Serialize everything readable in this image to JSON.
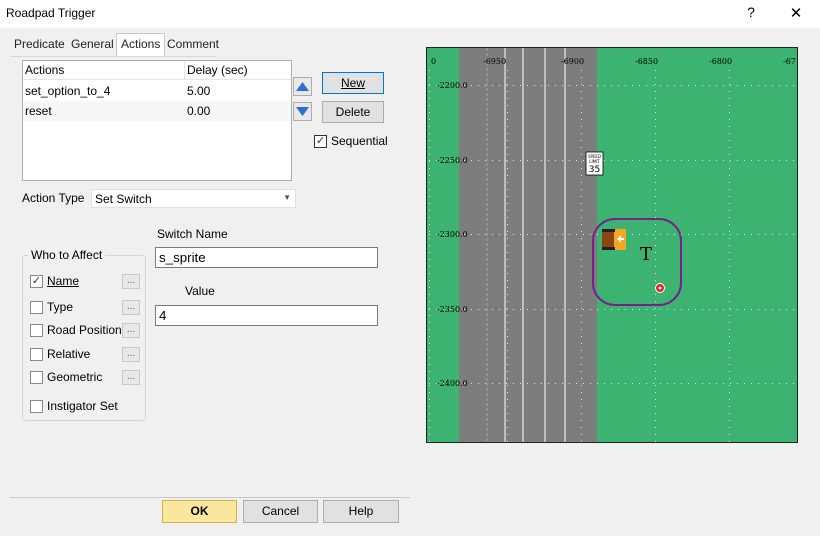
{
  "window": {
    "title": "Roadpad Trigger",
    "help": "?",
    "close": "✕"
  },
  "tabs": [
    {
      "label": "Predicate"
    },
    {
      "label": "General"
    },
    {
      "label": "Actions"
    },
    {
      "label": "Comment"
    }
  ],
  "actions_table": {
    "headers": [
      "Actions",
      "Delay (sec)"
    ],
    "rows": [
      {
        "action": "set_option_to_4",
        "delay": "5.00"
      },
      {
        "action": "reset",
        "delay": "0.00"
      }
    ]
  },
  "buttons": {
    "new": "New",
    "delete": "Delete",
    "ok": "OK",
    "cancel": "Cancel",
    "help": "Help"
  },
  "sequential": {
    "label": "Sequential",
    "checked": true
  },
  "action_type": {
    "label": "Action Type",
    "value": "Set Switch"
  },
  "who_to_affect": {
    "legend": "Who to Affect",
    "items": [
      {
        "label": "Name",
        "checked": true
      },
      {
        "label": "Type",
        "checked": false
      },
      {
        "label": "Road Position",
        "checked": false
      },
      {
        "label": "Relative",
        "checked": false
      },
      {
        "label": "Geometric",
        "checked": false
      }
    ],
    "instigator": {
      "label": "Instigator Set",
      "checked": false
    },
    "ellipsis": "..."
  },
  "switch_name": {
    "label": "Switch Name",
    "value": "s_sprite"
  },
  "value_field": {
    "label": "Value",
    "value": "4"
  },
  "map": {
    "x_ticks": [
      "0",
      "-6950",
      "-6900",
      "-6850",
      "-6800",
      "-67"
    ],
    "y_ticks": [
      "-2200.0",
      "-2250.0",
      "-2300.0",
      "-2350.0",
      "-2400.0"
    ],
    "sign_top": "SPEED",
    "sign_mid": "LIMIT",
    "sign_num": "35",
    "marker": "T",
    "colors": {
      "grass": "#3cb371",
      "road": "#808080",
      "trigger": "#7b1f8c",
      "vehicle": "#f5a623"
    }
  }
}
